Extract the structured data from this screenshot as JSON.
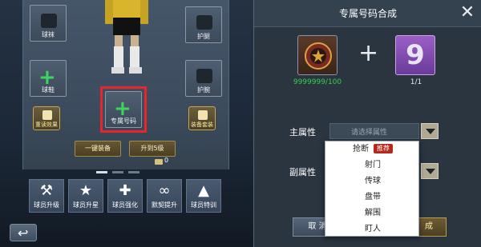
{
  "left": {
    "slots": {
      "socks": "球袜",
      "shinguard": "护腿",
      "boots": "球鞋",
      "gloves": "护腕",
      "exclusive_number": "专属号码"
    },
    "skills": {
      "left": "重读效果",
      "right": "装备套装"
    },
    "buttons": {
      "one_key_equip": "一键装备",
      "upgrade_five": "升到5级",
      "coin_count": "0"
    },
    "tabs": [
      "球员升级",
      "球员升星",
      "球员强化",
      "默契提升",
      "球员特训"
    ]
  },
  "dialog": {
    "title": "专属号码合成",
    "item1_count": "9999999/100",
    "item2_count": "1/1",
    "item2_number": "9",
    "plus_sign": "+",
    "main_attr_label": "主属性",
    "main_attr_placeholder": "请选择属性",
    "sub_attr_label": "副属性",
    "options": [
      "抢断",
      "射门",
      "传球",
      "盘带",
      "解围",
      "盯人"
    ],
    "recommend_badge": "推荐",
    "cancel_label": "取 消",
    "confirm_label": "成"
  },
  "colors": {
    "count_green": "#33d14a",
    "highlight_red": "#e6262a",
    "accent_gold": "#c9a54b"
  }
}
